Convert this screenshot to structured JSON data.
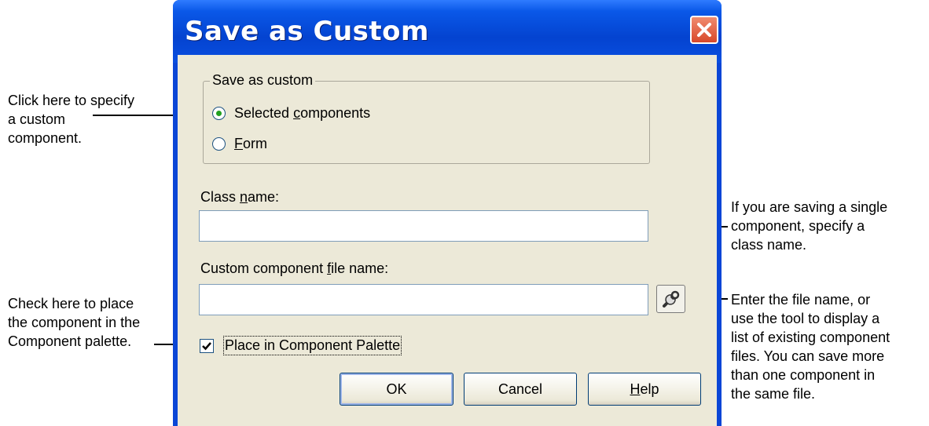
{
  "dialog": {
    "title": "Save as Custom",
    "group_label": "Save as custom",
    "options": [
      {
        "pre": "Selected ",
        "accel": "c",
        "post": "omponents",
        "checked": true
      },
      {
        "pre": "",
        "accel": "F",
        "post": "orm",
        "checked": false
      }
    ],
    "class_name": {
      "pre": "Class ",
      "accel": "n",
      "post": "ame:",
      "value": ""
    },
    "file_name": {
      "pre": "Custom component ",
      "accel": "f",
      "post": "ile name:",
      "value": ""
    },
    "palette_checkbox": {
      "label": "Place in Component Palette",
      "checked": true
    },
    "buttons": {
      "ok": "OK",
      "cancel": "Cancel",
      "help": {
        "accel": "H",
        "post": "elp"
      }
    }
  },
  "annotations": {
    "custom_component": [
      "Click here to specify",
      "a custom",
      "component."
    ],
    "palette": [
      "Check here to place",
      "the component in the",
      "Component palette."
    ],
    "class_name": [
      "If you are saving a single",
      "component, specify a",
      "class name."
    ],
    "file_name": [
      "Enter the file name, or",
      "use the tool to display a",
      "list of existing component",
      "files. You can save more",
      "than one component in",
      "the same file."
    ]
  },
  "icons": {
    "close": "close-icon",
    "tool": "wrench-icon",
    "check": "checkmark-icon"
  },
  "colors": {
    "titlebar": "#0443d0",
    "client": "#ece9d8",
    "close": "#d8482a"
  }
}
